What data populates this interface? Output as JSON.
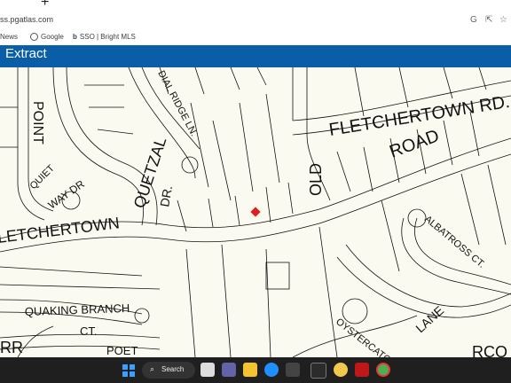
{
  "browser": {
    "new_tab_glyph": "+",
    "url": "ss.pgatlas.com",
    "right_icons": [
      "google-icon",
      "share-icon",
      "bookmark-star-icon",
      "side-panel-icon"
    ]
  },
  "bookmarks": [
    {
      "label": "News",
      "icon": "news-icon"
    },
    {
      "label": "Google",
      "icon": "google-icon"
    },
    {
      "label": "SSO | Bright MLS",
      "icon": "bright-mls-icon"
    }
  ],
  "banner": {
    "title": "Extract"
  },
  "map": {
    "labels": {
      "fletchertown_rd": "FLETCHERTOWN RD.",
      "road": "ROAD",
      "old": "OLD",
      "point": "POINT",
      "quiet": "QUIET",
      "way_dr": "WAY DR",
      "quetzal": "QUETZAL",
      "dr": "DR.",
      "dial_ridge_ln": "DIAL RIDGE LN.",
      "fletchertown": "LETCHERTOWN",
      "albatross_ct": "ALBATROSS CT.",
      "quaking_branch": "QUAKING BRANCH",
      "ct": "CT.",
      "poet": "POET",
      "oystercatcher": "OYSTERCATCHER",
      "lane": "LANE",
      "rr": "RR",
      "rco": "RCO"
    },
    "marker_color": "#e02020"
  },
  "taskbar": {
    "search_label": "Search",
    "apps": [
      "windows-start-icon",
      "search-icon",
      "file-explorer-icon",
      "teams-icon",
      "folder-icon",
      "edge-icon",
      "store-icon",
      "camera-icon",
      "chrome-canary-icon",
      "mcafee-icon",
      "chrome-icon"
    ]
  }
}
